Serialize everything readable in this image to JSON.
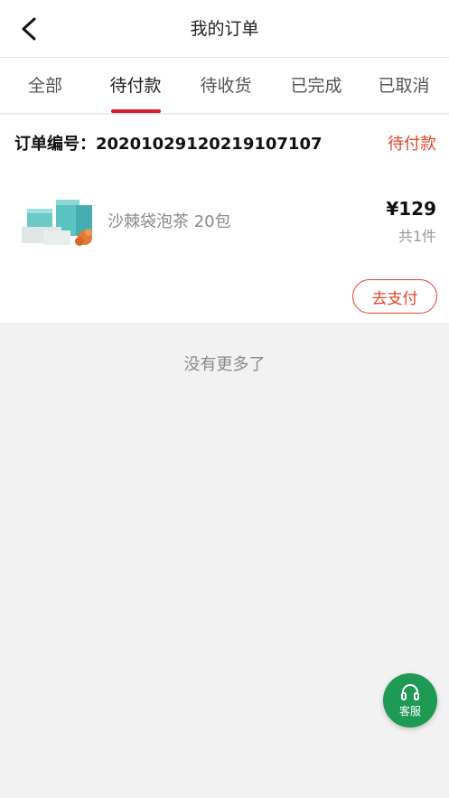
{
  "header": {
    "title": "我的订单"
  },
  "tabs": [
    {
      "label": "全部"
    },
    {
      "label": "待付款"
    },
    {
      "label": "待收货"
    },
    {
      "label": "已完成"
    },
    {
      "label": "已取消"
    }
  ],
  "active_tab": "待付款",
  "order": {
    "number_label": "订单编号：20201029120219107107",
    "status": "待付款",
    "product_name": "沙棘袋泡茶 20包",
    "price": "¥129",
    "quantity": "共1件",
    "pay_button": "去支付"
  },
  "list_end_text": "没有更多了",
  "customer_service": {
    "label": "客服"
  },
  "colors": {
    "accent_red": "#e0452c",
    "tab_underline": "#d81e2c",
    "service_green": "#1f9a55"
  }
}
